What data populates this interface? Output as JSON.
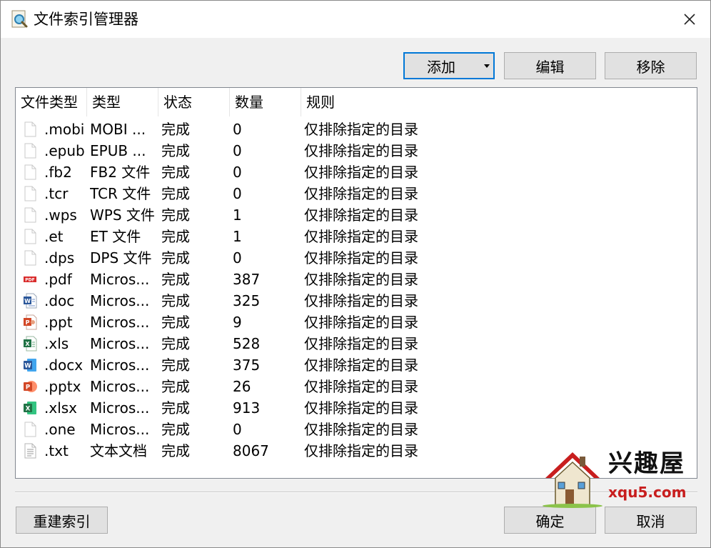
{
  "window": {
    "title": "文件索引管理器",
    "close_icon": "close-icon"
  },
  "toolbar": {
    "add_label": "添加",
    "edit_label": "编辑",
    "remove_label": "移除"
  },
  "table": {
    "columns": [
      "文件类型",
      "类型",
      "状态",
      "数量",
      "规则"
    ],
    "rows": [
      {
        "ext": ".mobi",
        "type": "MOBI ...",
        "status": "完成",
        "count": "0",
        "rule": "仅排除指定的目录",
        "icon": "blank"
      },
      {
        "ext": ".epub",
        "type": "EPUB ...",
        "status": "完成",
        "count": "0",
        "rule": "仅排除指定的目录",
        "icon": "blank"
      },
      {
        "ext": ".fb2",
        "type": "FB2 文件",
        "status": "完成",
        "count": "0",
        "rule": "仅排除指定的目录",
        "icon": "blank"
      },
      {
        "ext": ".tcr",
        "type": "TCR 文件",
        "status": "完成",
        "count": "0",
        "rule": "仅排除指定的目录",
        "icon": "blank"
      },
      {
        "ext": ".wps",
        "type": "WPS 文件",
        "status": "完成",
        "count": "1",
        "rule": "仅排除指定的目录",
        "icon": "blank"
      },
      {
        "ext": ".et",
        "type": "ET 文件",
        "status": "完成",
        "count": "1",
        "rule": "仅排除指定的目录",
        "icon": "blank"
      },
      {
        "ext": ".dps",
        "type": "DPS 文件",
        "status": "完成",
        "count": "0",
        "rule": "仅排除指定的目录",
        "icon": "blank"
      },
      {
        "ext": ".pdf",
        "type": "Micros...",
        "status": "完成",
        "count": "387",
        "rule": "仅排除指定的目录",
        "icon": "pdf"
      },
      {
        "ext": ".doc",
        "type": "Micros...",
        "status": "完成",
        "count": "325",
        "rule": "仅排除指定的目录",
        "icon": "word-old"
      },
      {
        "ext": ".ppt",
        "type": "Micros...",
        "status": "完成",
        "count": "9",
        "rule": "仅排除指定的目录",
        "icon": "ppt-old"
      },
      {
        "ext": ".xls",
        "type": "Micros...",
        "status": "完成",
        "count": "528",
        "rule": "仅排除指定的目录",
        "icon": "excel-old"
      },
      {
        "ext": ".docx",
        "type": "Micros...",
        "status": "完成",
        "count": "375",
        "rule": "仅排除指定的目录",
        "icon": "word"
      },
      {
        "ext": ".pptx",
        "type": "Micros...",
        "status": "完成",
        "count": "26",
        "rule": "仅排除指定的目录",
        "icon": "ppt"
      },
      {
        "ext": ".xlsx",
        "type": "Micros...",
        "status": "完成",
        "count": "913",
        "rule": "仅排除指定的目录",
        "icon": "excel"
      },
      {
        "ext": ".one",
        "type": "Micros...",
        "status": "完成",
        "count": "0",
        "rule": "仅排除指定的目录",
        "icon": "blank"
      },
      {
        "ext": ".txt",
        "type": "文本文档",
        "status": "完成",
        "count": "8067",
        "rule": "仅排除指定的目录",
        "icon": "text"
      }
    ]
  },
  "footer": {
    "rebuild_label": "重建索引",
    "ok_label": "确定",
    "cancel_label": "取消"
  },
  "watermark": {
    "name": "兴趣屋",
    "url": "xqu5.com"
  },
  "colors": {
    "accent": "#0078d7",
    "pdf_red": "#d92b2b",
    "word_blue": "#2b579a",
    "excel_green": "#217346",
    "ppt_orange": "#d24726"
  }
}
